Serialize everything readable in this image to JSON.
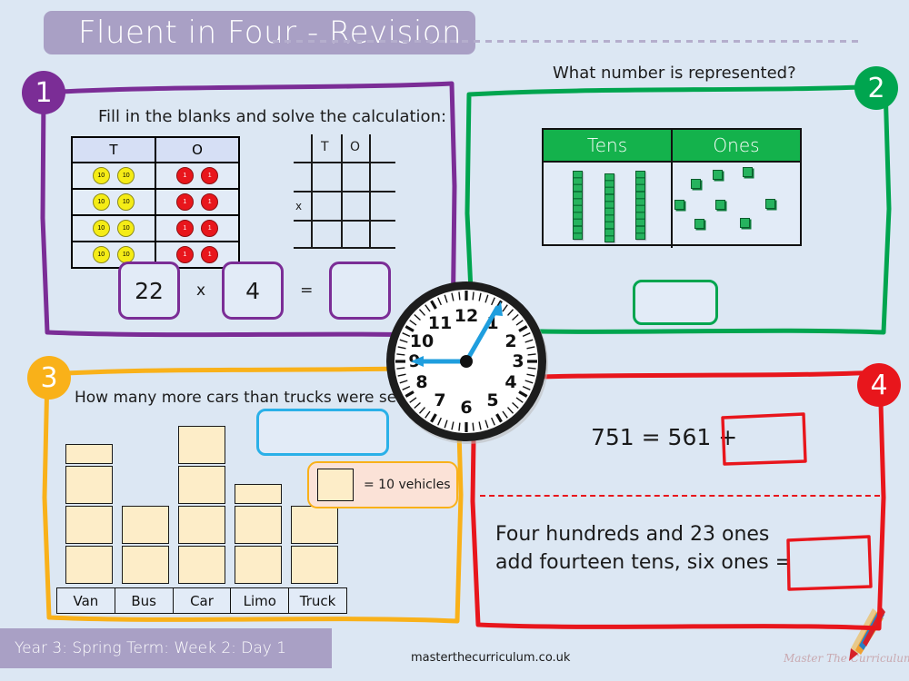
{
  "header": {
    "title": "Fluent in Four - Revision"
  },
  "panels": [
    {
      "number": "1",
      "color": "#7b2d96",
      "prompt": "Fill in the blanks and solve the calculation:",
      "place_value_table": {
        "headers": [
          "T",
          "O"
        ],
        "rows": [
          {
            "tens": [
              "10",
              "10"
            ],
            "ones": [
              "1",
              "1"
            ]
          },
          {
            "tens": [
              "10",
              "10"
            ],
            "ones": [
              "1",
              "1"
            ]
          },
          {
            "tens": [
              "10",
              "10"
            ],
            "ones": [
              "1",
              "1"
            ]
          },
          {
            "tens": [
              "10",
              "10"
            ],
            "ones": [
              "1",
              "1"
            ]
          }
        ]
      },
      "working_grid": {
        "headers": [
          "T",
          "O"
        ],
        "operator": "x"
      },
      "calculation": {
        "factor1": "22",
        "operator": "x",
        "factor2": "4",
        "equals": "=",
        "answer": ""
      }
    },
    {
      "number": "2",
      "color": "#00a54f",
      "prompt": "What number is represented?",
      "base_ten": {
        "headers": [
          "Tens",
          "Ones"
        ],
        "tens_count": 3,
        "ones_count": 8
      },
      "answer": ""
    },
    {
      "number": "3",
      "color": "#f9b119",
      "prompt": "How many more cars than trucks were seen?",
      "answer": "",
      "key_label": "= 10 vehicles",
      "key_value": 10
    },
    {
      "number": "4",
      "color": "#e8161c",
      "equation_1": {
        "text": "751 = 561 +",
        "answer": ""
      },
      "equation_2": {
        "line1": "Four hundreds and 23 ones",
        "line2": "add fourteen tens, six ones =",
        "answer": ""
      }
    }
  ],
  "chart_data": {
    "type": "bar",
    "title": "How many more cars than trucks were seen?",
    "categories": [
      "Van",
      "Bus",
      "Car",
      "Limo",
      "Truck"
    ],
    "values": [
      35,
      20,
      40,
      25,
      20
    ],
    "symbol_counts": [
      3.5,
      2,
      4,
      2.5,
      2
    ],
    "unit_label": "= 10 vehicles",
    "unit_value": 10,
    "xlabel": "",
    "ylabel": "",
    "legend": "= 10 vehicles"
  },
  "clock": {
    "hour_numbers": [
      "12",
      "1",
      "2",
      "3",
      "4",
      "5",
      "6",
      "7",
      "8",
      "9",
      "10",
      "11"
    ],
    "hour_hand": "9",
    "minute_hand": "1",
    "time": "9:05"
  },
  "footer": {
    "banner": "Year 3: Spring Term: Week 2: Day 1",
    "url": "masterthecurriculum.co.uk",
    "brand": "Master The Curriculum"
  }
}
